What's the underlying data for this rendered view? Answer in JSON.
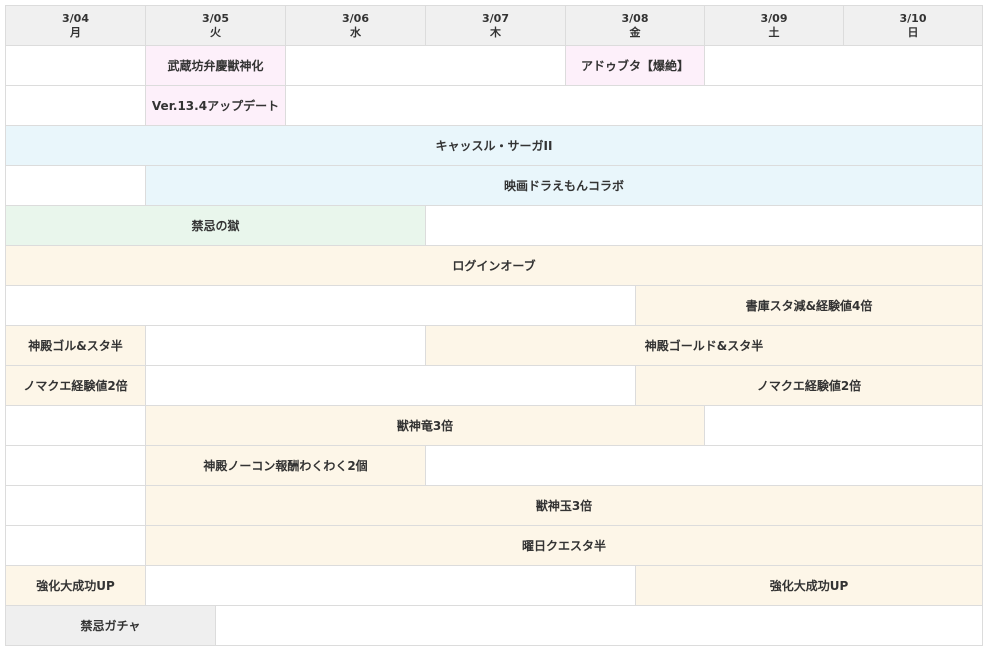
{
  "days": [
    {
      "date": "3/04",
      "dow": "月"
    },
    {
      "date": "3/05",
      "dow": "火"
    },
    {
      "date": "3/06",
      "dow": "水"
    },
    {
      "date": "3/07",
      "dow": "木"
    },
    {
      "date": "3/08",
      "dow": "金"
    },
    {
      "date": "3/09",
      "dow": "土"
    },
    {
      "date": "3/10",
      "dow": "日"
    }
  ],
  "events": {
    "r1a": "武蔵坊弁慶獣神化",
    "r1b": "アドゥブタ【爆絶】",
    "r2a": "Ver.13.4アップデート",
    "r3a": "キャッスル・サーガII",
    "r4a": "映画ドラえもんコラボ",
    "r5a": "禁忌の獄",
    "r6a": "ログインオーブ",
    "r7a": "書庫スタ減&経験値4倍",
    "r8a": "神殿ゴル&スタ半",
    "r8b": "神殿ゴールド&スタ半",
    "r9a": "ノマクエ経験値2倍",
    "r9b": "ノマクエ経験値2倍",
    "r10a": "獣神竜3倍",
    "r11a": "神殿ノーコン報酬わくわく2個",
    "r12a": "獣神玉3倍",
    "r13a": "曜日クエスタ半",
    "r14a": "強化大成功UP",
    "r14b": "強化大成功UP",
    "r15a": "禁忌ガチャ"
  },
  "colors": {
    "header": "#f0f0f0",
    "pink": "#fdf0fa",
    "blue": "#e9f6fb",
    "green": "#e9f6ec",
    "cream": "#fdf6e8",
    "gray": "#efefef"
  }
}
